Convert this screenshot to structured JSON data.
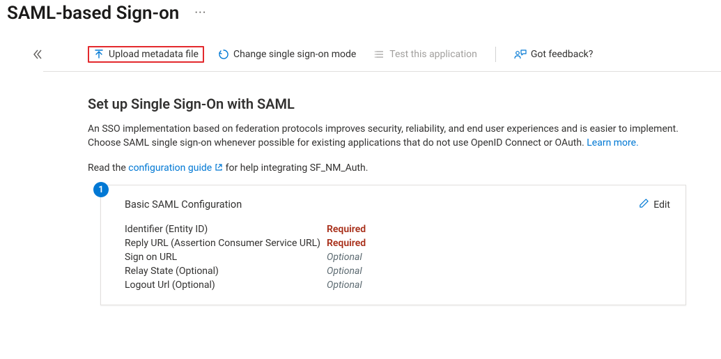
{
  "page": {
    "title": "SAML-based Sign-on"
  },
  "toolbar": {
    "upload": "Upload metadata file",
    "changeMode": "Change single sign-on mode",
    "test": "Test this application",
    "feedback": "Got feedback?"
  },
  "heading": "Set up Single Sign-On with SAML",
  "intro": {
    "text": "An SSO implementation based on federation protocols improves security, reliability, and end user experiences and is easier to implement. Choose SAML single sign-on whenever possible for existing applications that do not use OpenID Connect or OAuth. ",
    "learnMore": "Learn more."
  },
  "guide": {
    "prefix": "Read the ",
    "link": "configuration guide",
    "suffix": " for help integrating SF_NM_Auth."
  },
  "card": {
    "step": "1",
    "title": "Basic SAML Configuration",
    "edit": "Edit",
    "fields": [
      {
        "label": "Identifier (Entity ID)",
        "value": "Required",
        "kind": "req"
      },
      {
        "label": "Reply URL (Assertion Consumer Service URL)",
        "value": "Required",
        "kind": "req"
      },
      {
        "label": "Sign on URL",
        "value": "Optional",
        "kind": "opt"
      },
      {
        "label": "Relay State (Optional)",
        "value": "Optional",
        "kind": "opt"
      },
      {
        "label": "Logout Url (Optional)",
        "value": "Optional",
        "kind": "opt"
      }
    ]
  }
}
